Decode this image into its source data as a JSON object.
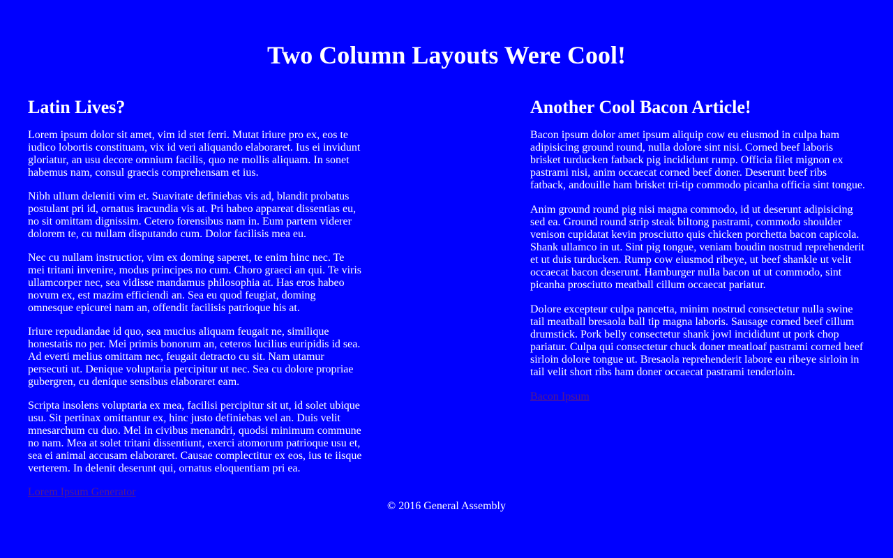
{
  "header": {
    "title": "Two Column Layouts Were Cool!"
  },
  "left_article": {
    "heading": "Latin Lives?",
    "paragraphs": [
      "Lorem ipsum dolor sit amet, vim id stet ferri. Mutat iriure pro ex, eos te iudico lobortis constituam, vix id veri aliquando elaboraret. Ius ei invidunt gloriatur, an usu decore omnium facilis, quo ne mollis aliquam. In sonet habemus nam, consul graecis comprehensam et ius.",
      "Nibh ullum deleniti vim et. Suavitate definiebas vis ad, blandit probatus postulant pri id, ornatus iracundia vis at. Pri habeo appareat dissentias eu, no sit omittam dignissim. Cetero forensibus nam in. Eum partem viderer dolorem te, cu nullam disputando cum. Dolor facilisis mea eu.",
      "Nec cu nullam instructior, vim ex doming saperet, te enim hinc nec. Te mei tritani invenire, modus principes no cum. Choro graeci an qui. Te viris ullamcorper nec, sea vidisse mandamus philosophia at. Has eros habeo novum ex, est mazim efficiendi an. Sea eu quod feugiat, doming omnesque epicurei nam an, offendit facilisis patrioque his at.",
      "Iriure repudiandae id quo, sea mucius aliquam feugait ne, similique honestatis no per. Mei primis bonorum an, ceteros lucilius euripidis id sea. Ad everti melius omittam nec, feugait detracto cu sit. Nam utamur persecuti ut. Denique voluptaria percipitur ut nec. Sea cu dolore propriae gubergren, cu denique sensibus elaboraret eam.",
      "Scripta insolens voluptaria ex mea, facilisi percipitur sit ut, id solet ubique usu. Sit pertinax omittantur ex, hinc justo definiebas vel an. Duis velit mnesarchum cu duo. Mel in civibus menandri, quodsi minimum commune no nam. Mea at solet tritani dissentiunt, exerci atomorum patrioque usu et, sea ei animal accusam elaboraret. Causae complectitur ex eos, ius te iisque verterem. In delenit deserunt qui, ornatus eloquentiam pri ea."
    ],
    "link_label": "Lorem Ipsum Generator"
  },
  "right_article": {
    "heading": "Another Cool Bacon Article!",
    "paragraphs": [
      "Bacon ipsum dolor amet ipsum aliquip cow eu eiusmod in culpa ham adipisicing ground round, nulla dolore sint nisi. Corned beef laboris brisket turducken fatback pig incididunt rump. Officia filet mignon ex pastrami nisi, anim occaecat corned beef doner. Deserunt beef ribs fatback, andouille ham brisket tri-tip commodo picanha officia sint tongue.",
      "Anim ground round pig nisi magna commodo, id ut deserunt adipisicing sed ea. Ground round strip steak biltong pastrami, commodo shoulder venison cupidatat kevin prosciutto quis chicken porchetta bacon capicola. Shank ullamco in ut. Sint pig tongue, veniam boudin nostrud reprehenderit et ut duis turducken. Rump cow eiusmod ribeye, ut beef shankle ut velit occaecat bacon deserunt. Hamburger nulla bacon ut ut commodo, sint picanha prosciutto meatball cillum occaecat pariatur.",
      "Dolore excepteur culpa pancetta, minim nostrud consectetur nulla swine tail meatball bresaola ball tip magna laboris. Sausage corned beef cillum drumstick. Pork belly consectetur shank jowl incididunt ut pork chop pariatur. Culpa qui consectetur chuck doner meatloaf pastrami corned beef sirloin dolore tongue ut. Bresaola reprehenderit labore eu ribeye sirloin in tail velit short ribs ham doner occaecat pastrami tenderloin."
    ],
    "link_label": "Bacon Ipsum"
  },
  "footer": {
    "text": "© 2016 General Assembly"
  },
  "colors": {
    "background": "#0000ff",
    "text": "#ffffff",
    "link": "#551a8b"
  }
}
